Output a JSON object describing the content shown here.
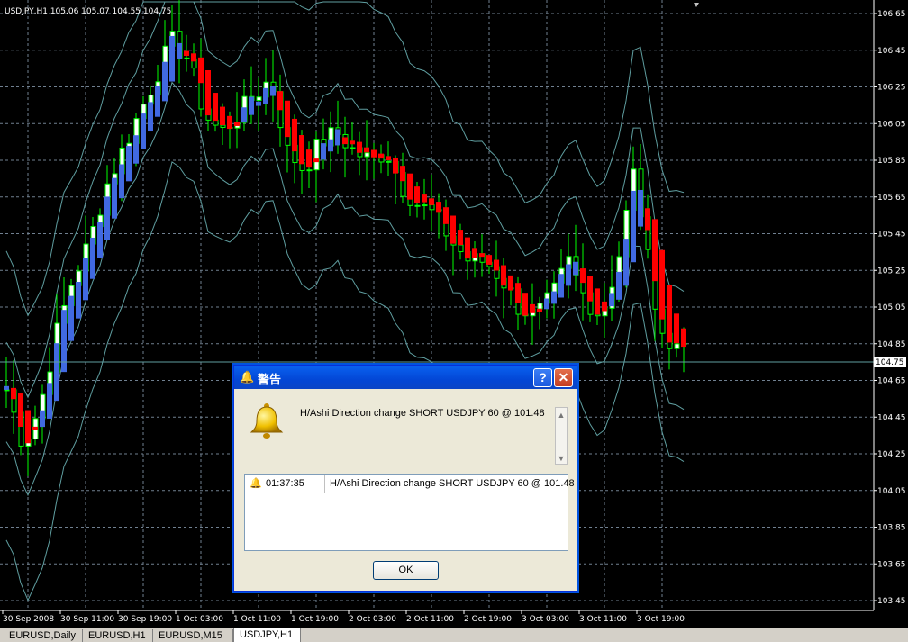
{
  "chart": {
    "header": "USDJPY,H1  105.06 105.07 104.55 104.75",
    "current_price": "104.75",
    "price_labels": [
      "106.65",
      "106.45",
      "106.25",
      "106.05",
      "105.85",
      "105.65",
      "105.45",
      "105.25",
      "105.05",
      "104.85",
      "104.65",
      "104.45",
      "104.25",
      "104.05",
      "103.85",
      "103.65",
      "103.45"
    ],
    "time_labels": [
      "30 Sep 2008",
      "30 Sep 11:00",
      "30 Sep 19:00",
      "1 Oct 03:00",
      "1 Oct 11:00",
      "1 Oct 19:00",
      "2 Oct 03:00",
      "2 Oct 11:00",
      "2 Oct 19:00",
      "3 Oct 03:00",
      "3 Oct 11:00",
      "3 Oct 19:00"
    ],
    "colors": {
      "background": "#000000",
      "candle": "#00ff00",
      "bull_body": "#ffffff",
      "ha_up": "#4169e1",
      "ha_down": "#ff0000",
      "bands": "#5f9ea0",
      "grid": "#708090"
    }
  },
  "chart_data": {
    "type": "candlestick",
    "symbol": "USDJPY",
    "timeframe": "H1",
    "ylim": [
      103.4,
      106.75
    ],
    "close_path": [
      104.6,
      104.3,
      104.5,
      104.9,
      105.2,
      105.4,
      105.7,
      105.9,
      106.1,
      106.3,
      106.5,
      106.4,
      106.1,
      106.0,
      106.1,
      106.2,
      106.3,
      105.9,
      105.8,
      105.95,
      106.0,
      105.9,
      105.85,
      105.9,
      105.7,
      105.6,
      105.55,
      105.4,
      105.3,
      105.3,
      105.2,
      105.05,
      105.0,
      105.1,
      105.3,
      105.1,
      105.0,
      105.3,
      105.8,
      105.2,
      104.8,
      104.9
    ]
  },
  "dialog": {
    "title": "警告",
    "message": "H/Ashi Direction change SHORT  USDJPY 60 @ 101.48",
    "rows": [
      {
        "time": "01:37:35",
        "message": "H/Ashi Direction change SHORT  USDJPY 60 @ 101.48"
      }
    ],
    "ok_label": "OK",
    "help_glyph": "?",
    "close_glyph": "✕"
  },
  "tabs": [
    {
      "label": "EURUSD,Daily",
      "active": false
    },
    {
      "label": "EURUSD,H1",
      "active": false
    },
    {
      "label": "EURUSD,M15",
      "active": false
    },
    {
      "label": "USDJPY,H1",
      "active": true
    }
  ]
}
